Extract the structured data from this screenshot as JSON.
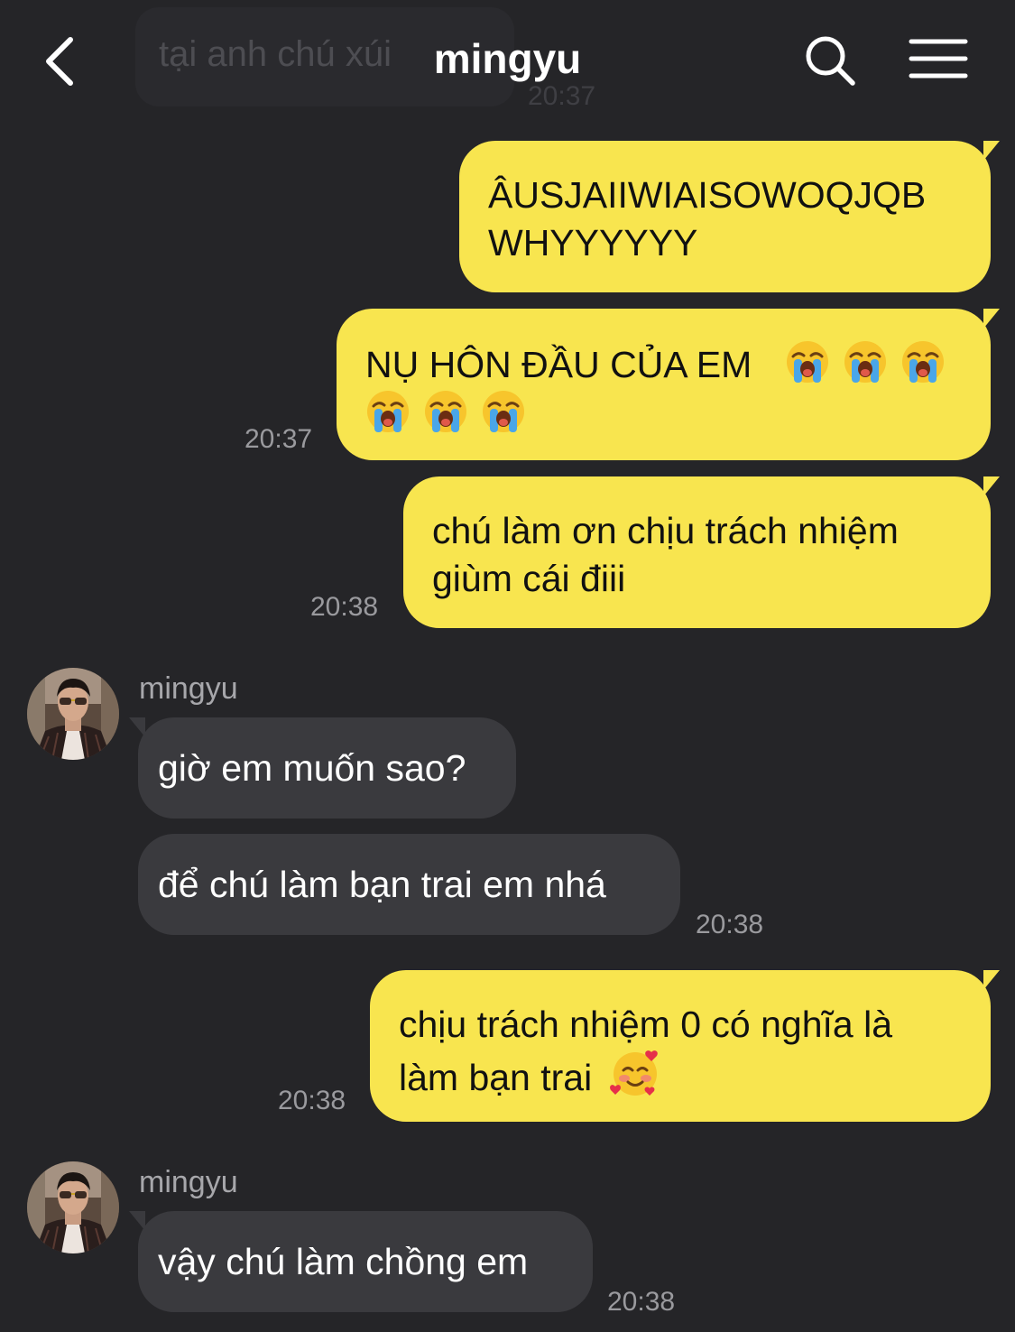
{
  "header": {
    "title": "mingyu",
    "previous_message_text": "tại anh chú xúi",
    "previous_message_time": "20:37",
    "back_icon": "chevron-left-icon",
    "search_icon": "search-icon",
    "menu_icon": "hamburger-menu-icon"
  },
  "colors": {
    "background": "#252528",
    "outgoing_bubble": "#f8e54f",
    "incoming_bubble": "#3a3a3e",
    "timestamp": "#9a9a9e"
  },
  "messages": {
    "m1": {
      "line1": "ÂUSJAIIWIAISOWOQJQB",
      "line2": "WHYYYYYY"
    },
    "m2": {
      "line1": "NỤ HÔN ĐẦU CỦA EM",
      "emoji": "loudly-crying-face",
      "emoji_count_line1": 3,
      "emoji_count_line2": 3,
      "time": "20:37"
    },
    "m3": {
      "line1": "chú làm ơn chịu trách nhiệm",
      "line2": "giùm cái điii",
      "time": "20:38"
    },
    "g1": {
      "sender": "mingyu",
      "msg1": "giờ em muốn sao?",
      "msg2": "để chú làm bạn trai em nhá",
      "time": "20:38"
    },
    "m4": {
      "line1": "chịu trách nhiệm 0 có nghĩa là",
      "line2": "làm bạn trai",
      "emoji": "smiling-face-with-hearts",
      "time": "20:38"
    },
    "g2": {
      "sender": "mingyu",
      "msg1": "vậy chú làm chồng em",
      "time": "20:38"
    }
  }
}
